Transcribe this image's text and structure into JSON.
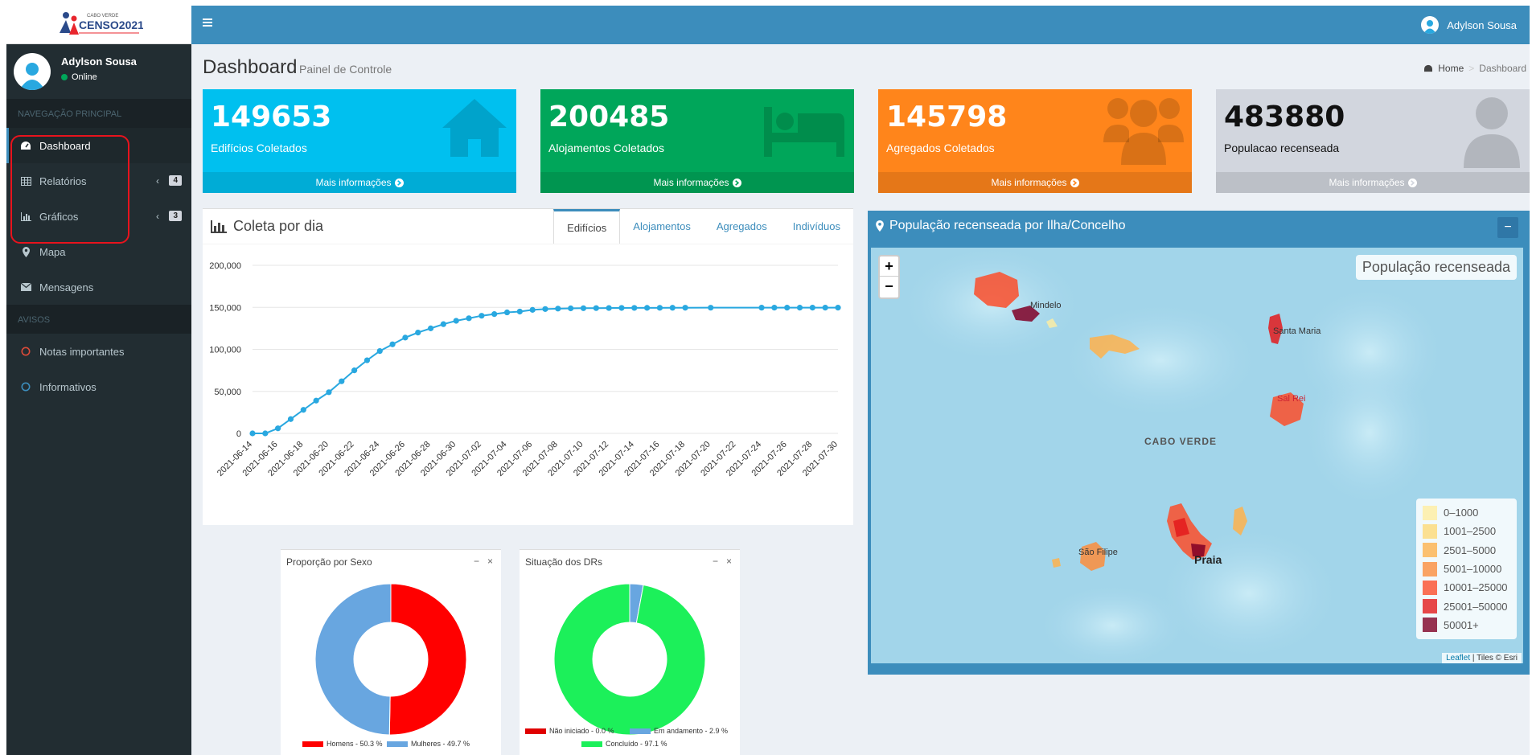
{
  "app": {
    "logo_text": "CENSO2021",
    "logo_subtext": "CABO VERDE"
  },
  "navbar": {
    "user_name": "Adylson Sousa"
  },
  "sidebar": {
    "user_name": "Adylson Sousa",
    "user_status": "Online",
    "sections": {
      "main_nav": "NAVEGAÇÃO PRINCIPAL",
      "notices": "AVISOS"
    },
    "items": [
      {
        "label": "Dashboard",
        "icon": "dashboard-icon",
        "active": true
      },
      {
        "label": "Relatórios",
        "icon": "table-icon",
        "badge": "4"
      },
      {
        "label": "Gráficos",
        "icon": "bar-chart-icon",
        "badge": "3"
      },
      {
        "label": "Mapa",
        "icon": "map-marker-icon"
      },
      {
        "label": "Mensagens",
        "icon": "envelope-icon"
      }
    ],
    "notices": [
      {
        "label": "Notas importantes",
        "color": "#dd4b39"
      },
      {
        "label": "Informativos",
        "color": "#3c8dbc"
      }
    ]
  },
  "header": {
    "title": "Dashboard",
    "subtitle": "Painel de Controle",
    "breadcrumb": [
      "Home",
      "Dashboard"
    ]
  },
  "stats": [
    {
      "value": "149653",
      "label": "Edifícios Coletados",
      "footer": "Mais informações",
      "color": "#00c0ef",
      "icon": "home-icon"
    },
    {
      "value": "200485",
      "label": "Alojamentos Coletados",
      "footer": "Mais informações",
      "color": "#00a65a",
      "icon": "bed-icon"
    },
    {
      "value": "145798",
      "label": "Agregados Coletados",
      "footer": "Mais informações",
      "color": "#ff851b",
      "icon": "users-icon"
    },
    {
      "value": "483880",
      "label": "Populacao recenseada",
      "footer": "Mais informações",
      "color": "#d2d6de",
      "icon": "user-icon"
    }
  ],
  "line_chart": {
    "title": "Coleta por dia",
    "tabs": [
      "Edifícios",
      "Alojamentos",
      "Agregados",
      "Indivíduos"
    ],
    "active_tab": "Edifícios"
  },
  "donuts": [
    {
      "title": "Proporção por Sexo"
    },
    {
      "title": "Situação dos DRs"
    }
  ],
  "map": {
    "title": "População recenseada por Ilha/Concelho",
    "info_label": "População recenseada",
    "country_label": "CABO VERDE",
    "place_labels": [
      "Mindelo",
      "Santa Maria",
      "Sal Rei",
      "São Filipe",
      "Praia"
    ],
    "legend": [
      {
        "label": "0–1000",
        "color": "#ffeda0"
      },
      {
        "label": "1001–2500",
        "color": "#fed976"
      },
      {
        "label": "2501–5000",
        "color": "#feb24c"
      },
      {
        "label": "5001–10000",
        "color": "#fd8d3c"
      },
      {
        "label": "10001–25000",
        "color": "#fc4e2a"
      },
      {
        "label": "25001–50000",
        "color": "#e31a1c"
      },
      {
        "label": "50001+",
        "color": "#800026"
      }
    ],
    "zoom_in": "+",
    "zoom_out": "−",
    "attribution_link": "Leaflet",
    "attribution_text": "| Tiles © Esri"
  },
  "chart_data": [
    {
      "type": "line",
      "title": "Coleta por dia",
      "ylim": [
        0,
        200000
      ],
      "yticks": [
        "0",
        "50,000",
        "100,000",
        "150,000",
        "200,000"
      ],
      "x_tick_labels": [
        "2021-06-14",
        "2021-06-16",
        "2021-06-18",
        "2021-06-20",
        "2021-06-22",
        "2021-06-24",
        "2021-06-26",
        "2021-06-28",
        "2021-06-30",
        "2021-07-02",
        "2021-07-04",
        "2021-07-06",
        "2021-07-08",
        "2021-07-10",
        "2021-07-12",
        "2021-07-14",
        "2021-07-16",
        "2021-07-18",
        "2021-07-20",
        "2021-07-22",
        "2021-07-24",
        "2021-07-26",
        "2021-07-28",
        "2021-07-30"
      ],
      "color": "#29a8e0",
      "grid": true,
      "series": [
        {
          "x": [
            "2021-06-14",
            "2021-06-15",
            "2021-06-16",
            "2021-06-17",
            "2021-06-18",
            "2021-06-19",
            "2021-06-20",
            "2021-06-21",
            "2021-06-22",
            "2021-06-23",
            "2021-06-24",
            "2021-06-25",
            "2021-06-26",
            "2021-06-27",
            "2021-06-28",
            "2021-06-29",
            "2021-06-30",
            "2021-07-01",
            "2021-07-02",
            "2021-07-03",
            "2021-07-04",
            "2021-07-05",
            "2021-07-06",
            "2021-07-07",
            "2021-07-08",
            "2021-07-09",
            "2021-07-10",
            "2021-07-11",
            "2021-07-12",
            "2021-07-13",
            "2021-07-14",
            "2021-07-15",
            "2021-07-16",
            "2021-07-17",
            "2021-07-18",
            "2021-07-20",
            "2021-07-24",
            "2021-07-25",
            "2021-07-26",
            "2021-07-27",
            "2021-07-28",
            "2021-07-29",
            "2021-07-30"
          ],
          "values": [
            0,
            0,
            6000,
            17000,
            28000,
            39000,
            49000,
            62000,
            75000,
            87000,
            98000,
            106000,
            114000,
            120000,
            125000,
            130000,
            134000,
            137000,
            140000,
            142000,
            144000,
            145000,
            147000,
            148000,
            148500,
            148800,
            149000,
            149100,
            149200,
            149300,
            149350,
            149400,
            149450,
            149500,
            149550,
            149600,
            149620,
            149630,
            149640,
            149645,
            149650,
            149652,
            149653
          ]
        }
      ]
    },
    {
      "type": "pie",
      "title": "Proporção por Sexo",
      "series": [
        {
          "name": "Homens - 50.3 %",
          "value": 50.3,
          "color": "#ff0000"
        },
        {
          "name": "Mulheres - 49.7 %",
          "value": 49.7,
          "color": "#68a6e0"
        }
      ],
      "legend": "bottom"
    },
    {
      "type": "pie",
      "title": "Situação dos DRs",
      "series": [
        {
          "name": "Não iniciado - 0.0 %",
          "value": 0.0,
          "color": "#e00000"
        },
        {
          "name": "Em andamento - 2.9 %",
          "value": 2.9,
          "color": "#68a6e0"
        },
        {
          "name": "Concluído - 97.1 %",
          "value": 97.1,
          "color": "#1cf05a"
        }
      ],
      "legend": "bottom"
    }
  ]
}
